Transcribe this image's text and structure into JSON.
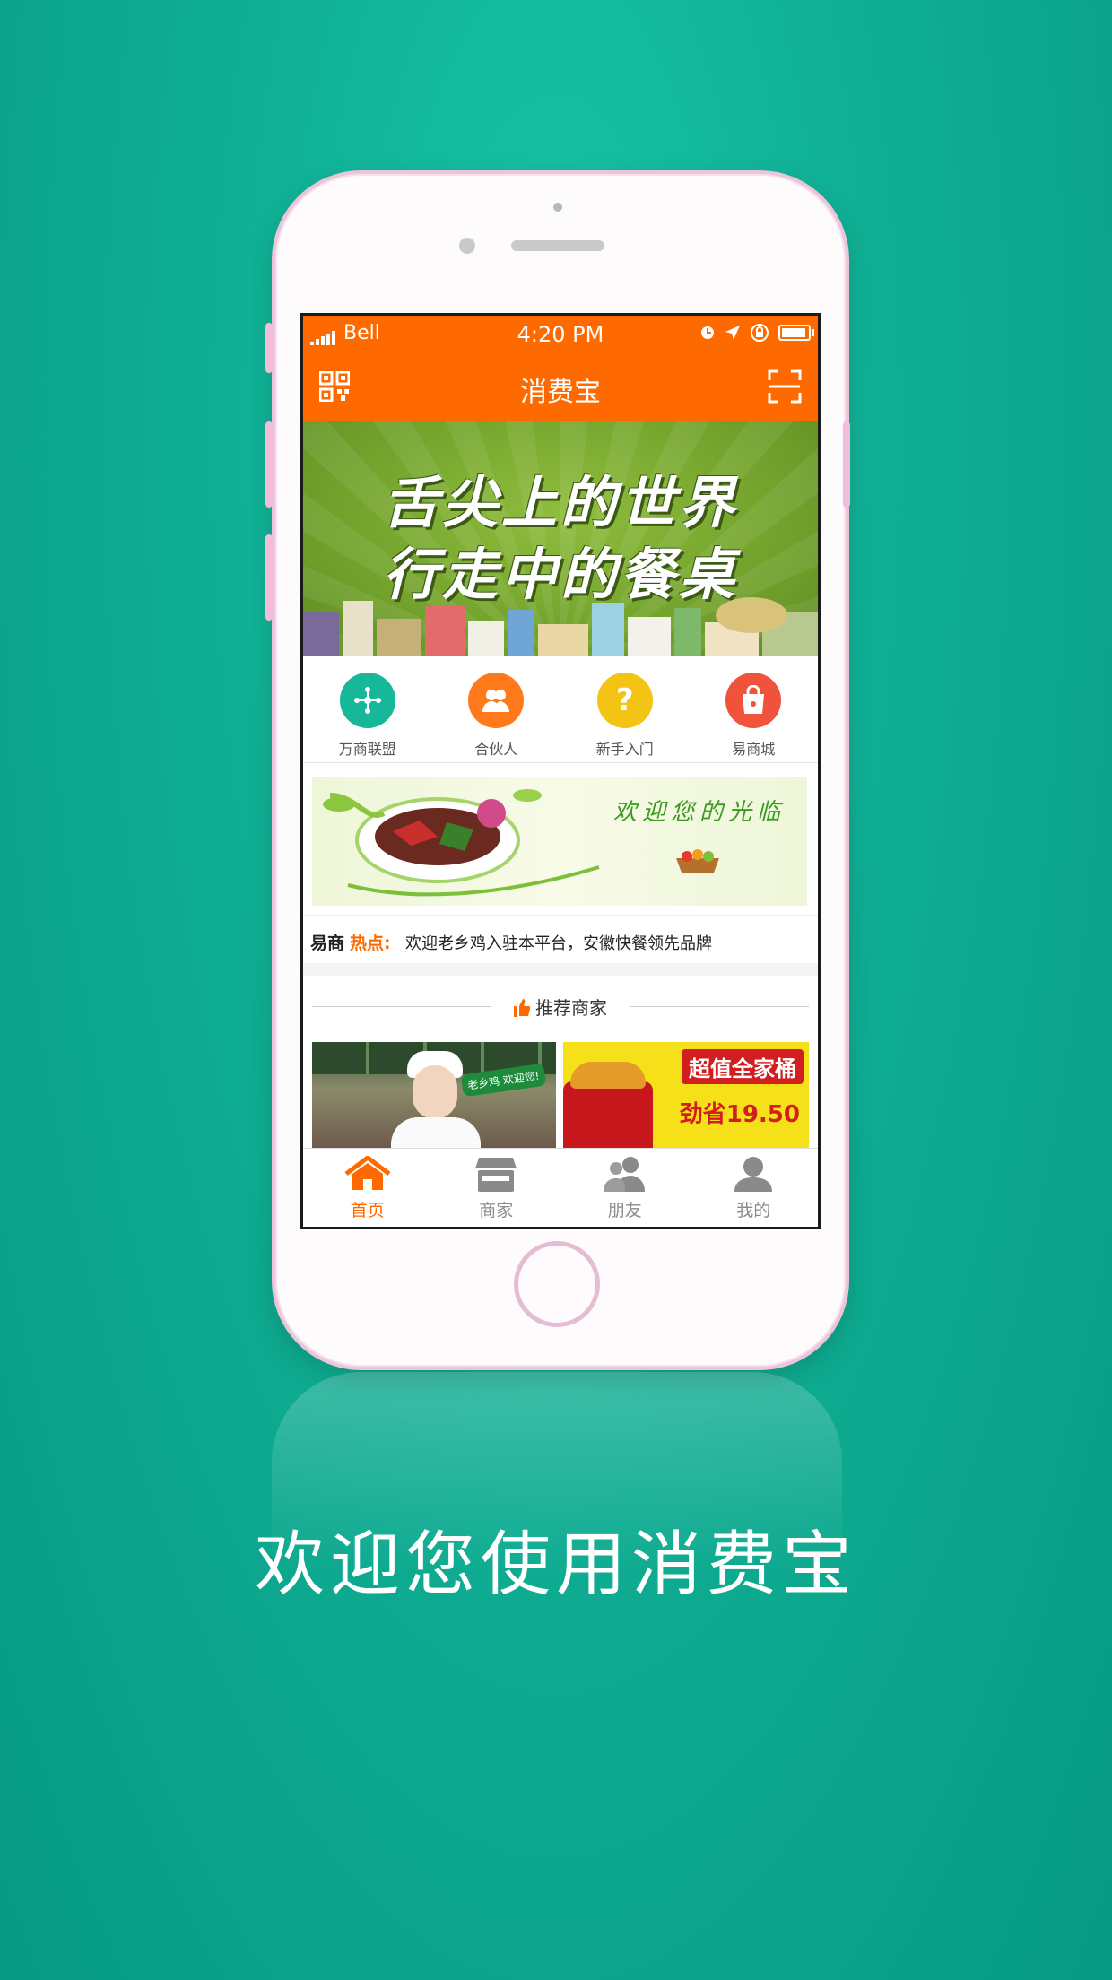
{
  "status_bar": {
    "carrier": "Bell",
    "time": "4:20 PM"
  },
  "navbar": {
    "title": "消费宝"
  },
  "banner": {
    "line1": "舌尖上的世界",
    "line2": "行走中的餐桌"
  },
  "quick_nav": [
    {
      "label": "万商联盟",
      "icon": "network-icon",
      "color": "#17b79a"
    },
    {
      "label": "合伙人",
      "icon": "partner-icon",
      "color": "#ff7a1a"
    },
    {
      "label": "新手入门",
      "icon": "question-icon",
      "color": "#f4c414"
    },
    {
      "label": "易商城",
      "icon": "shopping-bag-icon",
      "color": "#f0533c"
    }
  ],
  "promo": {
    "text": "欢迎您的光临"
  },
  "hot": {
    "tag_brand": "易商",
    "tag_hot": "热点:",
    "message": "欢迎老乡鸡入驻本平台，安徽快餐领先品牌"
  },
  "recommend": {
    "label": "推荐商家"
  },
  "shops": [
    {
      "badge": "老乡鸡 欢迎您!"
    },
    {
      "headline": "超值全家桶",
      "save": "劲省19.50"
    }
  ],
  "tabs": [
    {
      "label": "首页",
      "icon": "home-icon",
      "active": true
    },
    {
      "label": "商家",
      "icon": "store-icon",
      "active": false
    },
    {
      "label": "朋友",
      "icon": "friends-icon",
      "active": false
    },
    {
      "label": "我的",
      "icon": "profile-icon",
      "active": false
    }
  ],
  "welcome": "欢迎您使用消费宝",
  "colors": {
    "accent": "#ff6a00",
    "background": "#0fae93"
  }
}
